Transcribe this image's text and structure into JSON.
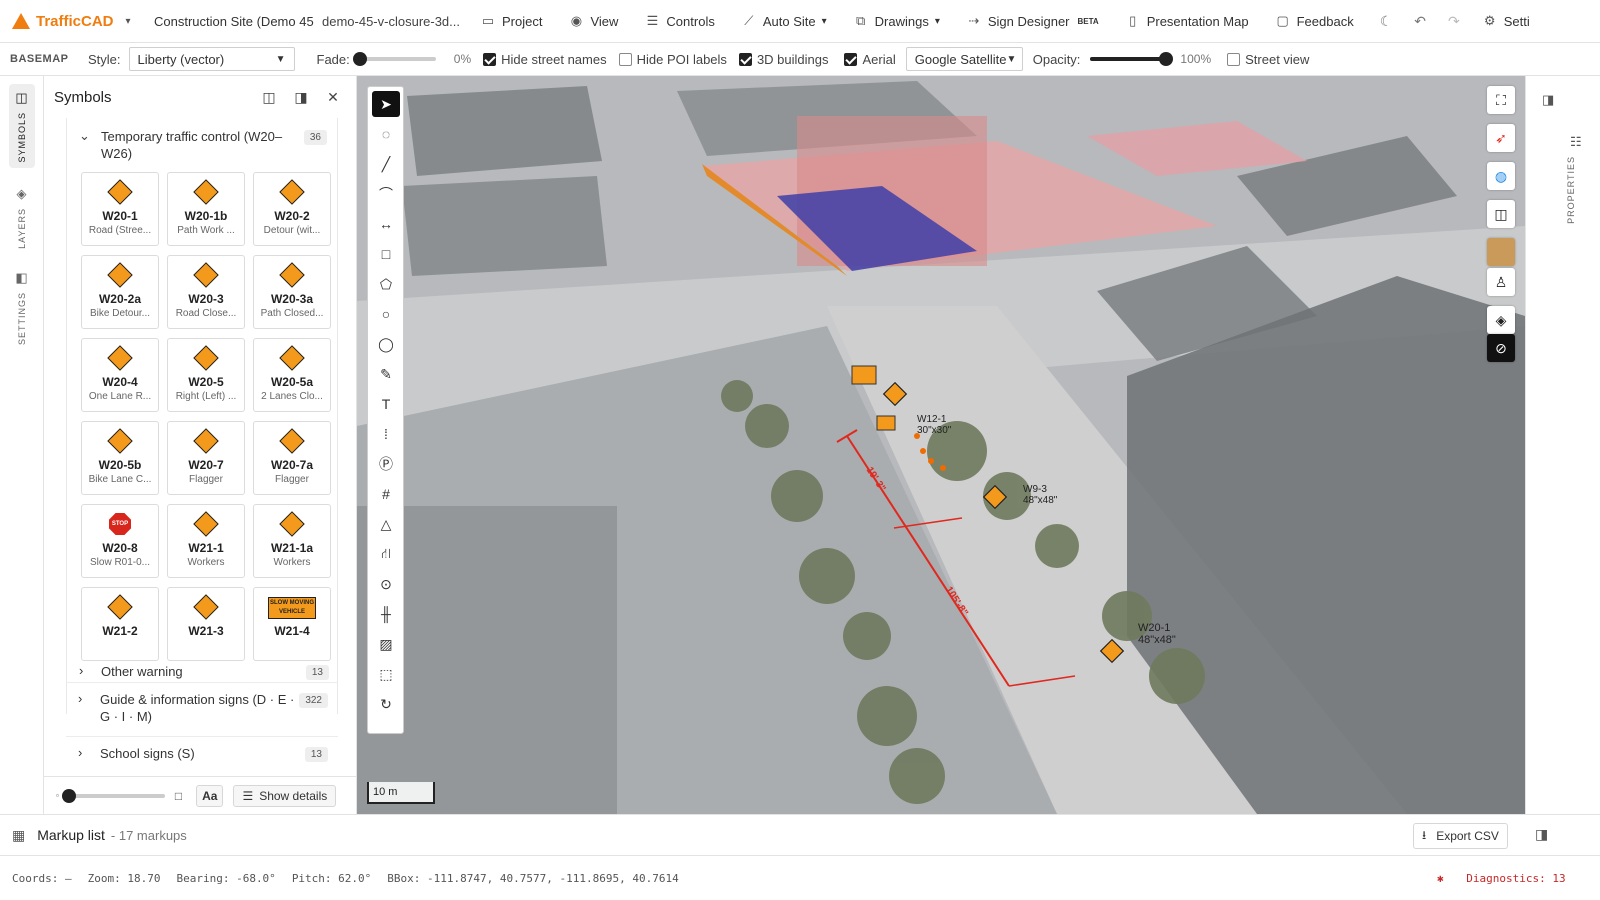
{
  "topbar": {
    "brand": "TrafficCAD",
    "project_title": "Construction Site (Demo 45",
    "project_slug": "demo-45-v-closure-3d...",
    "nav": [
      {
        "label": "Project",
        "icon": "folder-icon"
      },
      {
        "label": "View",
        "icon": "eye-icon"
      },
      {
        "label": "Controls",
        "icon": "sliders-icon"
      },
      {
        "label": "Auto Site",
        "icon": "wand-icon"
      },
      {
        "label": "Drawings",
        "icon": "drawings-icon"
      },
      {
        "label": "Sign Designer",
        "icon": "sign-icon",
        "badge": "BETA"
      },
      {
        "label": "Presentation Map",
        "icon": "book-icon"
      },
      {
        "label": "Feedback",
        "icon": "chat-icon"
      }
    ],
    "settings_label": "Setti"
  },
  "basemap": {
    "heading": "BASEMAP",
    "style_label": "Style:",
    "style_value": "Liberty (vector)",
    "fade_label": "Fade:",
    "fade_value": "0%",
    "fade_fraction": 0,
    "hide_street_names": "Hide street names",
    "hide_poi_labels": "Hide POI labels",
    "buildings_3d": "3D buildings",
    "aerial": "Aerial",
    "aerial_source": "Google Satellite",
    "opacity_label": "Opacity:",
    "opacity_value": "100%",
    "opacity_fraction": 1,
    "street_view": "Street view",
    "checks": {
      "hide_street_names": true,
      "hide_poi_labels": false,
      "buildings_3d": true,
      "aerial": true,
      "street_view": false
    }
  },
  "rail": {
    "symbols": "SYMBOLS",
    "layers": "LAYERS",
    "settings": "SETTINGS"
  },
  "symbols": {
    "title": "Symbols",
    "group_title": "Temporary traffic control (W20–W26)",
    "group_count": "36",
    "signs": [
      {
        "code": "W20-1",
        "desc": "Road (Stree...",
        "shape": "diamond"
      },
      {
        "code": "W20-1b",
        "desc": "Path Work ...",
        "shape": "diamond"
      },
      {
        "code": "W20-2",
        "desc": "Detour (wit...",
        "shape": "diamond"
      },
      {
        "code": "W20-2a",
        "desc": "Bike Detour...",
        "shape": "diamond"
      },
      {
        "code": "W20-3",
        "desc": "Road Close...",
        "shape": "diamond"
      },
      {
        "code": "W20-3a",
        "desc": "Path Closed...",
        "shape": "diamond"
      },
      {
        "code": "W20-4",
        "desc": "One Lane R...",
        "shape": "diamond"
      },
      {
        "code": "W20-5",
        "desc": "Right (Left) ...",
        "shape": "diamond"
      },
      {
        "code": "W20-5a",
        "desc": "2 Lanes Clo...",
        "shape": "diamond"
      },
      {
        "code": "W20-5b",
        "desc": "Bike Lane C...",
        "shape": "diamond"
      },
      {
        "code": "W20-7",
        "desc": "Flagger",
        "shape": "diamond"
      },
      {
        "code": "W20-7a",
        "desc": "Flagger",
        "shape": "diamond"
      },
      {
        "code": "W20-8",
        "desc": "Slow R01-0...",
        "shape": "octagon",
        "sign_text": "STOP"
      },
      {
        "code": "W21-1",
        "desc": "Workers",
        "shape": "diamond"
      },
      {
        "code": "W21-1a",
        "desc": "Workers",
        "shape": "diamond"
      },
      {
        "code": "W21-2",
        "desc": "",
        "shape": "diamond"
      },
      {
        "code": "W21-3",
        "desc": "",
        "shape": "diamond"
      },
      {
        "code": "W21-4",
        "desc": "",
        "shape": "rect",
        "sign_text": "SLOW MOVING VEHICLE"
      }
    ],
    "sections": [
      {
        "label": "Other warning",
        "count": "13"
      },
      {
        "label": "Guide & information signs (D · E · G · I · M)",
        "count": "322"
      },
      {
        "label": "School signs (S)",
        "count": "13"
      }
    ],
    "size_fraction": 0,
    "aa_label": "Aa",
    "details_label": "Show details"
  },
  "map": {
    "scale": "10 m",
    "dimension_1": "19'-3\"",
    "dimension_2": "105'-8\"",
    "labels": [
      {
        "code": "W12-1",
        "size": "30\"x30\""
      },
      {
        "code": "W9-3",
        "size": "48\"x48\""
      },
      {
        "code": "W20-1",
        "size": "48\"x48\""
      }
    ]
  },
  "right_rail": {
    "properties": "PROPERTIES"
  },
  "markup": {
    "title": "Markup list",
    "count": "- 17 markups",
    "export": "Export CSV"
  },
  "status": {
    "coords": "Coords: —",
    "zoom": "Zoom: 18.70",
    "bearing": "Bearing: -68.0°",
    "pitch": "Pitch: 62.0°",
    "bbox": "BBox: -111.8747, 40.7577, -111.8695, 40.7614",
    "diagnostics": "Diagnostics: 13"
  },
  "colors": {
    "brand": "#ef7d0f",
    "dimension": "#e0281e",
    "sign": "#f39a1c",
    "error": "#c62828"
  }
}
